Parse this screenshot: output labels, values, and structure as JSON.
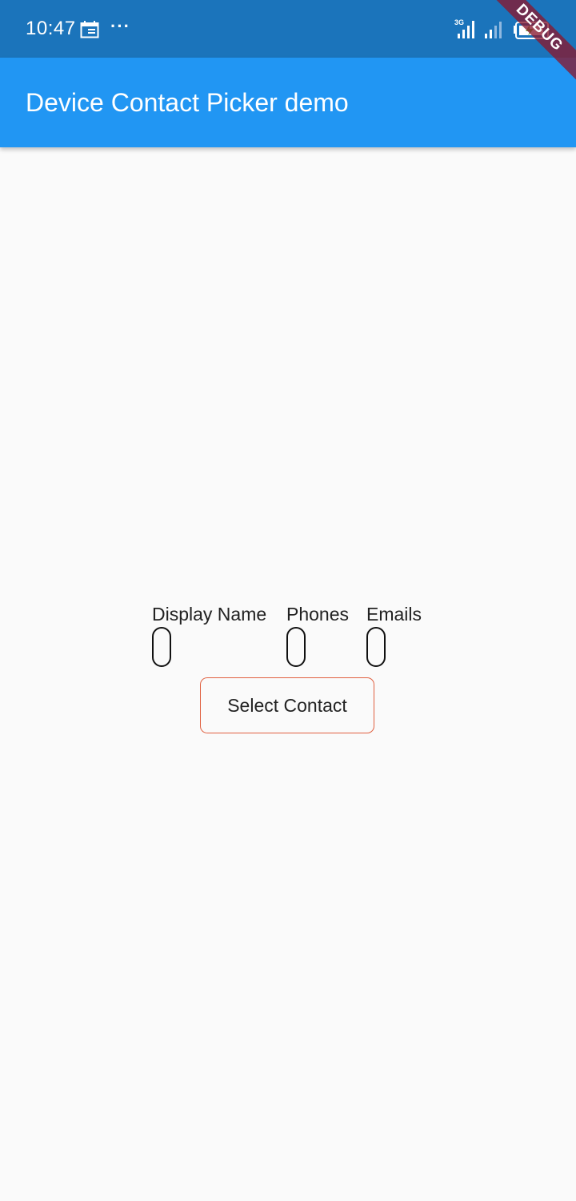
{
  "status_bar": {
    "time": "10:47",
    "more_indicator": "···",
    "network_type": "3G",
    "icons": [
      "calendar-icon",
      "more-icon",
      "signal-icon",
      "signal-icon",
      "battery-icon"
    ]
  },
  "debug_banner": {
    "label": "DEBUG",
    "color": "#881830"
  },
  "app_bar": {
    "title": "Device Contact Picker demo",
    "background_color": "#2196f3"
  },
  "contact_fields": [
    {
      "label": "Display Name",
      "value": ""
    },
    {
      "label": "Phones",
      "value": ""
    },
    {
      "label": "Emails",
      "value": ""
    }
  ],
  "actions": {
    "select_contact_label": "Select Contact",
    "border_color": "#e06040"
  }
}
